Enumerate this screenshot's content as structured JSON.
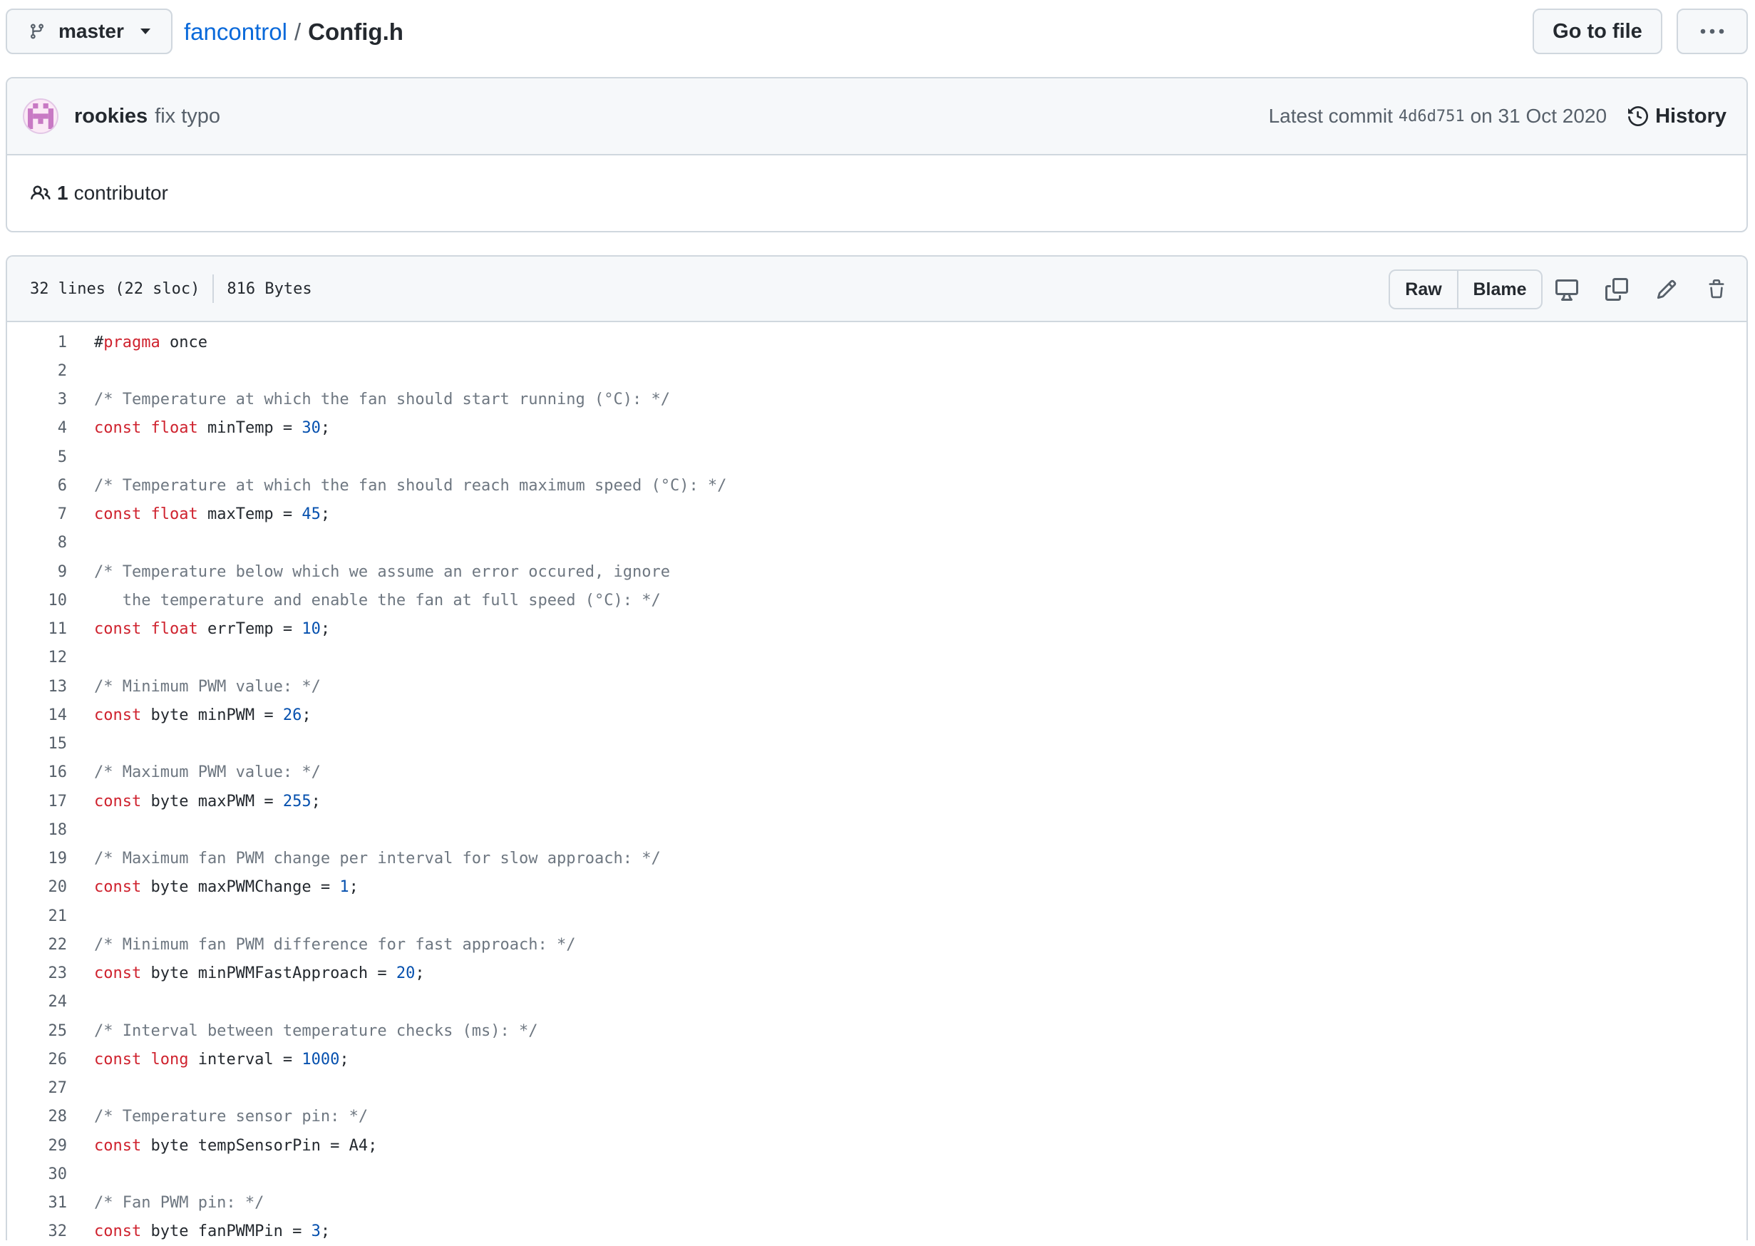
{
  "topbar": {
    "branch": "master",
    "repo": "fancontrol",
    "separator": "/",
    "file": "Config.h",
    "goto_label": "Go to file"
  },
  "commit": {
    "author": "rookies",
    "message": "fix typo",
    "latest_prefix": "Latest commit",
    "sha": "4d6d751",
    "date_text": "on 31 Oct 2020",
    "history_label": "History",
    "contributor_count": "1",
    "contributor_label": "contributor"
  },
  "file_info": {
    "lines": "32 lines (22 sloc)",
    "size": "816 Bytes",
    "raw_label": "Raw",
    "blame_label": "Blame"
  },
  "icons": {
    "branch": "git-branch-icon",
    "caret": "triangle-down-icon",
    "more": "kebab-horizontal-icon",
    "history": "history-icon",
    "people": "people-icon",
    "desktop": "desktop-icon",
    "copy": "copy-icon",
    "edit": "pencil-icon",
    "delete": "trash-icon"
  },
  "colors": {
    "link": "#0969da",
    "keyword": "#cf222e",
    "number": "#0550ae",
    "comment": "#6e7781",
    "border": "#d0d7de"
  },
  "code_lines": [
    [
      [
        "plain",
        "#"
      ],
      [
        "kw",
        "pragma"
      ],
      [
        "plain",
        " once"
      ]
    ],
    [],
    [
      [
        "com",
        "/* Temperature at which the fan should start running (°C): */"
      ]
    ],
    [
      [
        "kw",
        "const"
      ],
      [
        "plain",
        " "
      ],
      [
        "kw",
        "float"
      ],
      [
        "plain",
        " minTemp = "
      ],
      [
        "num",
        "30"
      ],
      [
        "plain",
        ";"
      ]
    ],
    [],
    [
      [
        "com",
        "/* Temperature at which the fan should reach maximum speed (°C): */"
      ]
    ],
    [
      [
        "kw",
        "const"
      ],
      [
        "plain",
        " "
      ],
      [
        "kw",
        "float"
      ],
      [
        "plain",
        " maxTemp = "
      ],
      [
        "num",
        "45"
      ],
      [
        "plain",
        ";"
      ]
    ],
    [],
    [
      [
        "com",
        "/* Temperature below which we assume an error occured, ignore"
      ]
    ],
    [
      [
        "com",
        "   the temperature and enable the fan at full speed (°C): */"
      ]
    ],
    [
      [
        "kw",
        "const"
      ],
      [
        "plain",
        " "
      ],
      [
        "kw",
        "float"
      ],
      [
        "plain",
        " errTemp = "
      ],
      [
        "num",
        "10"
      ],
      [
        "plain",
        ";"
      ]
    ],
    [],
    [
      [
        "com",
        "/* Minimum PWM value: */"
      ]
    ],
    [
      [
        "kw",
        "const"
      ],
      [
        "plain",
        " byte minPWM = "
      ],
      [
        "num",
        "26"
      ],
      [
        "plain",
        ";"
      ]
    ],
    [],
    [
      [
        "com",
        "/* Maximum PWM value: */"
      ]
    ],
    [
      [
        "kw",
        "const"
      ],
      [
        "plain",
        " byte maxPWM = "
      ],
      [
        "num",
        "255"
      ],
      [
        "plain",
        ";"
      ]
    ],
    [],
    [
      [
        "com",
        "/* Maximum fan PWM change per interval for slow approach: */"
      ]
    ],
    [
      [
        "kw",
        "const"
      ],
      [
        "plain",
        " byte maxPWMChange = "
      ],
      [
        "num",
        "1"
      ],
      [
        "plain",
        ";"
      ]
    ],
    [],
    [
      [
        "com",
        "/* Minimum fan PWM difference for fast approach: */"
      ]
    ],
    [
      [
        "kw",
        "const"
      ],
      [
        "plain",
        " byte minPWMFastApproach = "
      ],
      [
        "num",
        "20"
      ],
      [
        "plain",
        ";"
      ]
    ],
    [],
    [
      [
        "com",
        "/* Interval between temperature checks (ms): */"
      ]
    ],
    [
      [
        "kw",
        "const"
      ],
      [
        "plain",
        " "
      ],
      [
        "kw",
        "long"
      ],
      [
        "plain",
        " interval = "
      ],
      [
        "num",
        "1000"
      ],
      [
        "plain",
        ";"
      ]
    ],
    [],
    [
      [
        "com",
        "/* Temperature sensor pin: */"
      ]
    ],
    [
      [
        "kw",
        "const"
      ],
      [
        "plain",
        " byte tempSensorPin = A4;"
      ]
    ],
    [],
    [
      [
        "com",
        "/* Fan PWM pin: */"
      ]
    ],
    [
      [
        "kw",
        "const"
      ],
      [
        "plain",
        " byte fanPWMPin = "
      ],
      [
        "num",
        "3"
      ],
      [
        "plain",
        ";"
      ]
    ]
  ]
}
